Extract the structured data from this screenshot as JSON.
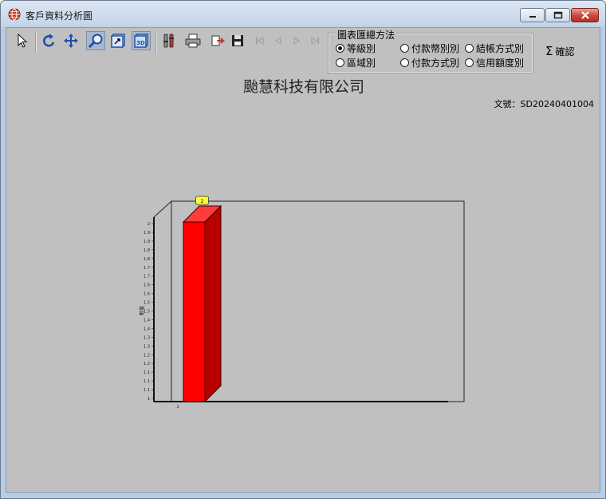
{
  "window": {
    "title": "客戶資料分析圖"
  },
  "toolbar": {
    "buttons": [
      {
        "name": "pointer-icon"
      },
      {
        "name": "rotate-icon"
      },
      {
        "name": "move-icon"
      },
      {
        "name": "zoom-icon"
      },
      {
        "name": "export-icon"
      },
      {
        "name": "3d-toggle-icon"
      },
      {
        "name": "settings-icon"
      },
      {
        "name": "print-icon"
      },
      {
        "name": "copy-icon"
      },
      {
        "name": "save-icon"
      },
      {
        "name": "first-page-icon"
      },
      {
        "name": "prev-page-icon"
      },
      {
        "name": "next-page-icon"
      },
      {
        "name": "last-page-icon"
      }
    ]
  },
  "summary_method": {
    "title": "圖表匯總方法",
    "options": [
      {
        "label": "等級別",
        "selected": true
      },
      {
        "label": "區域別",
        "selected": false
      },
      {
        "label": "付款幣別別",
        "selected": false
      },
      {
        "label": "付款方式別",
        "selected": false
      },
      {
        "label": "結帳方式別",
        "selected": false
      },
      {
        "label": "信用額度別",
        "selected": false
      }
    ]
  },
  "confirm_label": "確認",
  "company_name": "颱慧科技有限公司",
  "doc_number": "文號：SD20240401004",
  "chart_data": {
    "type": "bar",
    "categories": [
      "1"
    ],
    "values": [
      2
    ],
    "ylabel": "數量",
    "ylim": [
      1,
      2
    ],
    "yticks": [
      "1",
      "1.1",
      "1.1",
      "1.1",
      "1.2",
      "1.2",
      "1.3",
      "1.3",
      "1.4",
      "1.4",
      "1.5",
      "1.5",
      "1.6",
      "1.6",
      "1.7",
      "1.7",
      "1.8",
      "1.8",
      "1.9",
      "1.9",
      "2"
    ],
    "data_labels": [
      "2"
    ],
    "bar_color": "#ff0000",
    "style": "3d",
    "grid": false
  }
}
